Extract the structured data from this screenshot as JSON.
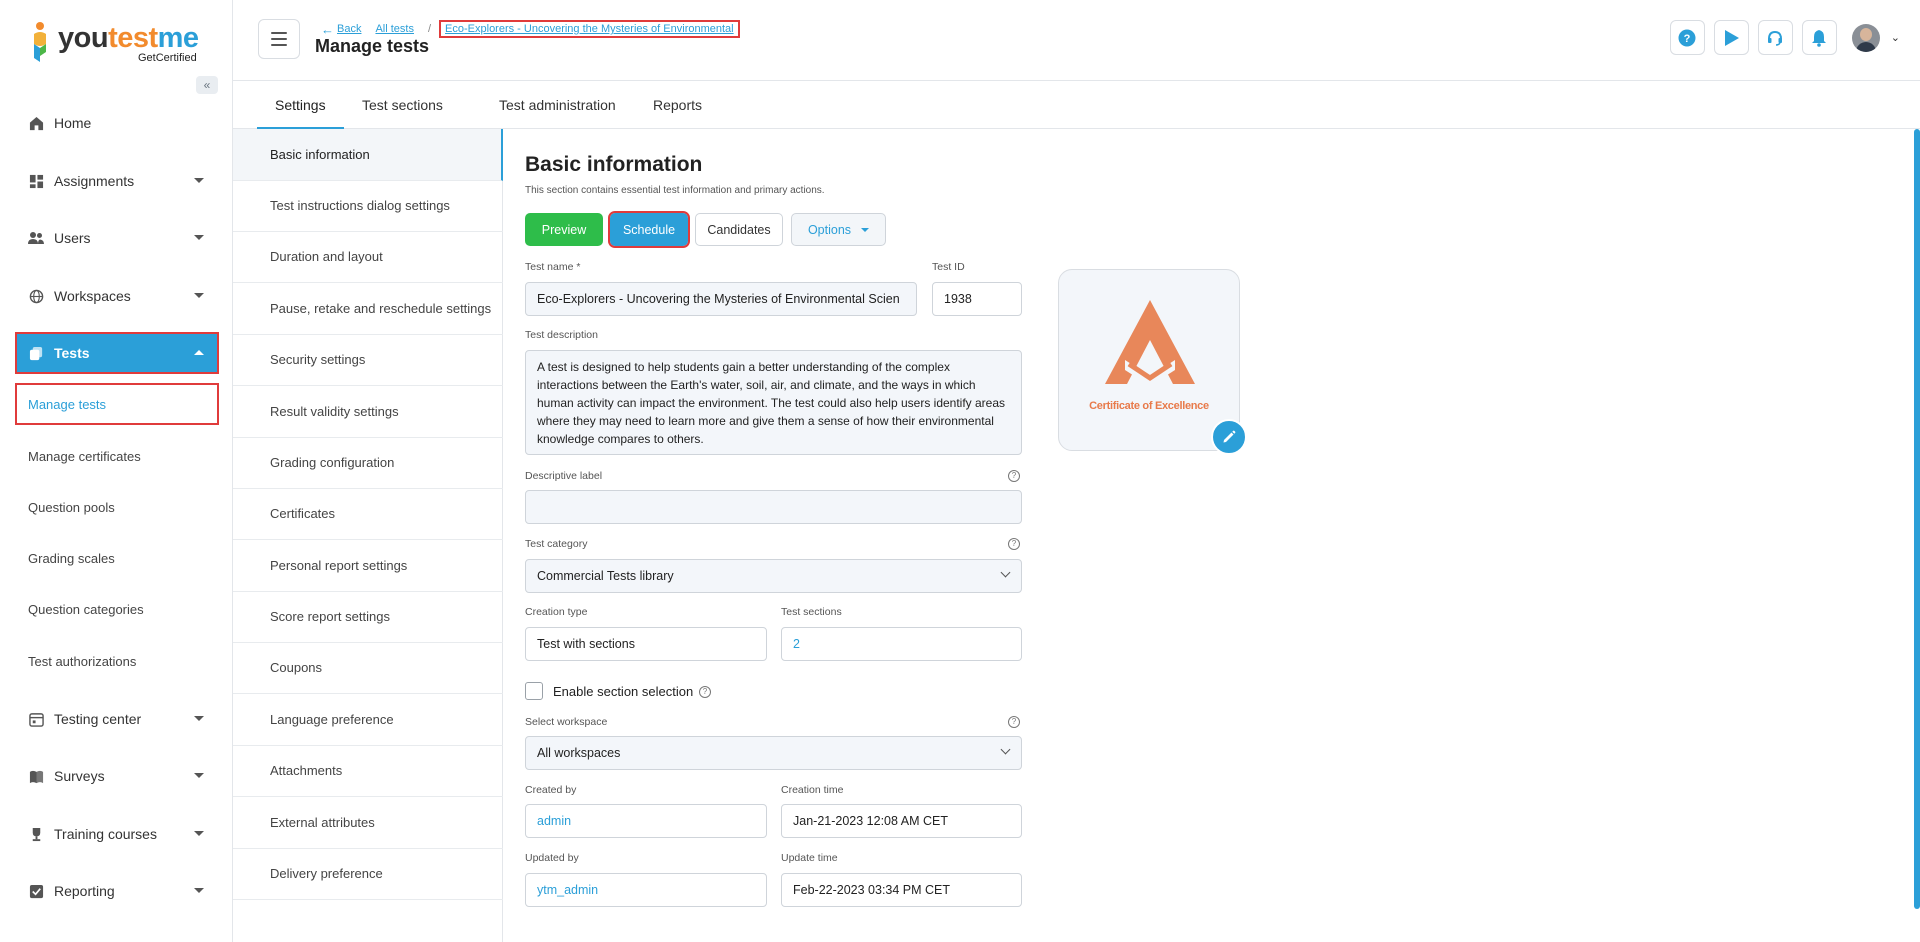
{
  "brand": {
    "name_part1": "you",
    "name_part2": "test",
    "name_part3": "me",
    "sub": "GetCertified",
    "accent": "#2b9fd8",
    "orange": "#f28b2d"
  },
  "sidebar": {
    "collapse_icon": "double-chevron-left-icon",
    "items": [
      {
        "label": "Home",
        "icon": "home-icon"
      },
      {
        "label": "Assignments",
        "icon": "dashboard-icon"
      },
      {
        "label": "Users",
        "icon": "users-icon"
      },
      {
        "label": "Workspaces",
        "icon": "globe-icon"
      },
      {
        "label": "Tests",
        "icon": "tests-icon"
      },
      {
        "label": "Testing center",
        "icon": "calendar-icon"
      },
      {
        "label": "Surveys",
        "icon": "survey-icon"
      },
      {
        "label": "Training courses",
        "icon": "trophy-icon"
      },
      {
        "label": "Reporting",
        "icon": "report-icon"
      }
    ],
    "tests_sub": [
      "Manage tests",
      "Manage certificates",
      "Question pools",
      "Grading scales",
      "Question categories",
      "Test authorizations"
    ]
  },
  "header": {
    "back": "Back",
    "all_tests": "All tests",
    "separator": "/",
    "current_test": "Eco-Explorers - Uncovering the Mysteries of Environmental",
    "title": "Manage tests"
  },
  "tabs": [
    "Settings",
    "Test sections",
    "Test administration",
    "Reports"
  ],
  "settings_list": [
    "Basic information",
    "Test instructions dialog settings",
    "Duration and layout",
    "Pause, retake and reschedule settings",
    "Security settings",
    "Result validity settings",
    "Grading configuration",
    "Certificates",
    "Personal report settings",
    "Score report settings",
    "Coupons",
    "Language preference",
    "Attachments",
    "External attributes",
    "Delivery preference"
  ],
  "main": {
    "title": "Basic information",
    "description": "This section contains essential test information and primary actions.",
    "buttons": {
      "preview": "Preview",
      "schedule": "Schedule",
      "candidates": "Candidates",
      "options": "Options"
    },
    "test_name_label": "Test name *",
    "test_name": "Eco-Explorers - Uncovering the Mysteries of Environmental Scien",
    "test_id_label": "Test ID",
    "test_id": "1938",
    "test_description_label": "Test description",
    "test_description": "A test is designed to help students gain a better understanding of the complex interactions between the Earth's water, soil, air, and climate, and the ways in which human activity can impact the environment. The test could also help users identify areas where they may need to learn more and give them a sense of how their environmental knowledge compares to others.",
    "descriptive_label_label": "Descriptive label",
    "descriptive_label": "",
    "test_category_label": "Test category",
    "test_category": "Commercial Tests library",
    "creation_type_label": "Creation type",
    "creation_type": "Test with sections",
    "test_sections_label": "Test sections",
    "test_sections": "2",
    "enable_section_selection": "Enable section selection",
    "select_workspace_label": "Select workspace",
    "select_workspace": "All workspaces",
    "created_by_label": "Created by",
    "created_by": "admin",
    "creation_time_label": "Creation time",
    "creation_time": "Jan-21-2023 12:08 AM CET",
    "updated_by_label": "Updated by",
    "updated_by": "ytm_admin",
    "update_time_label": "Update time",
    "update_time": "Feb-22-2023 03:34 PM CET",
    "certificate_text": "Certificate of Excellence"
  }
}
